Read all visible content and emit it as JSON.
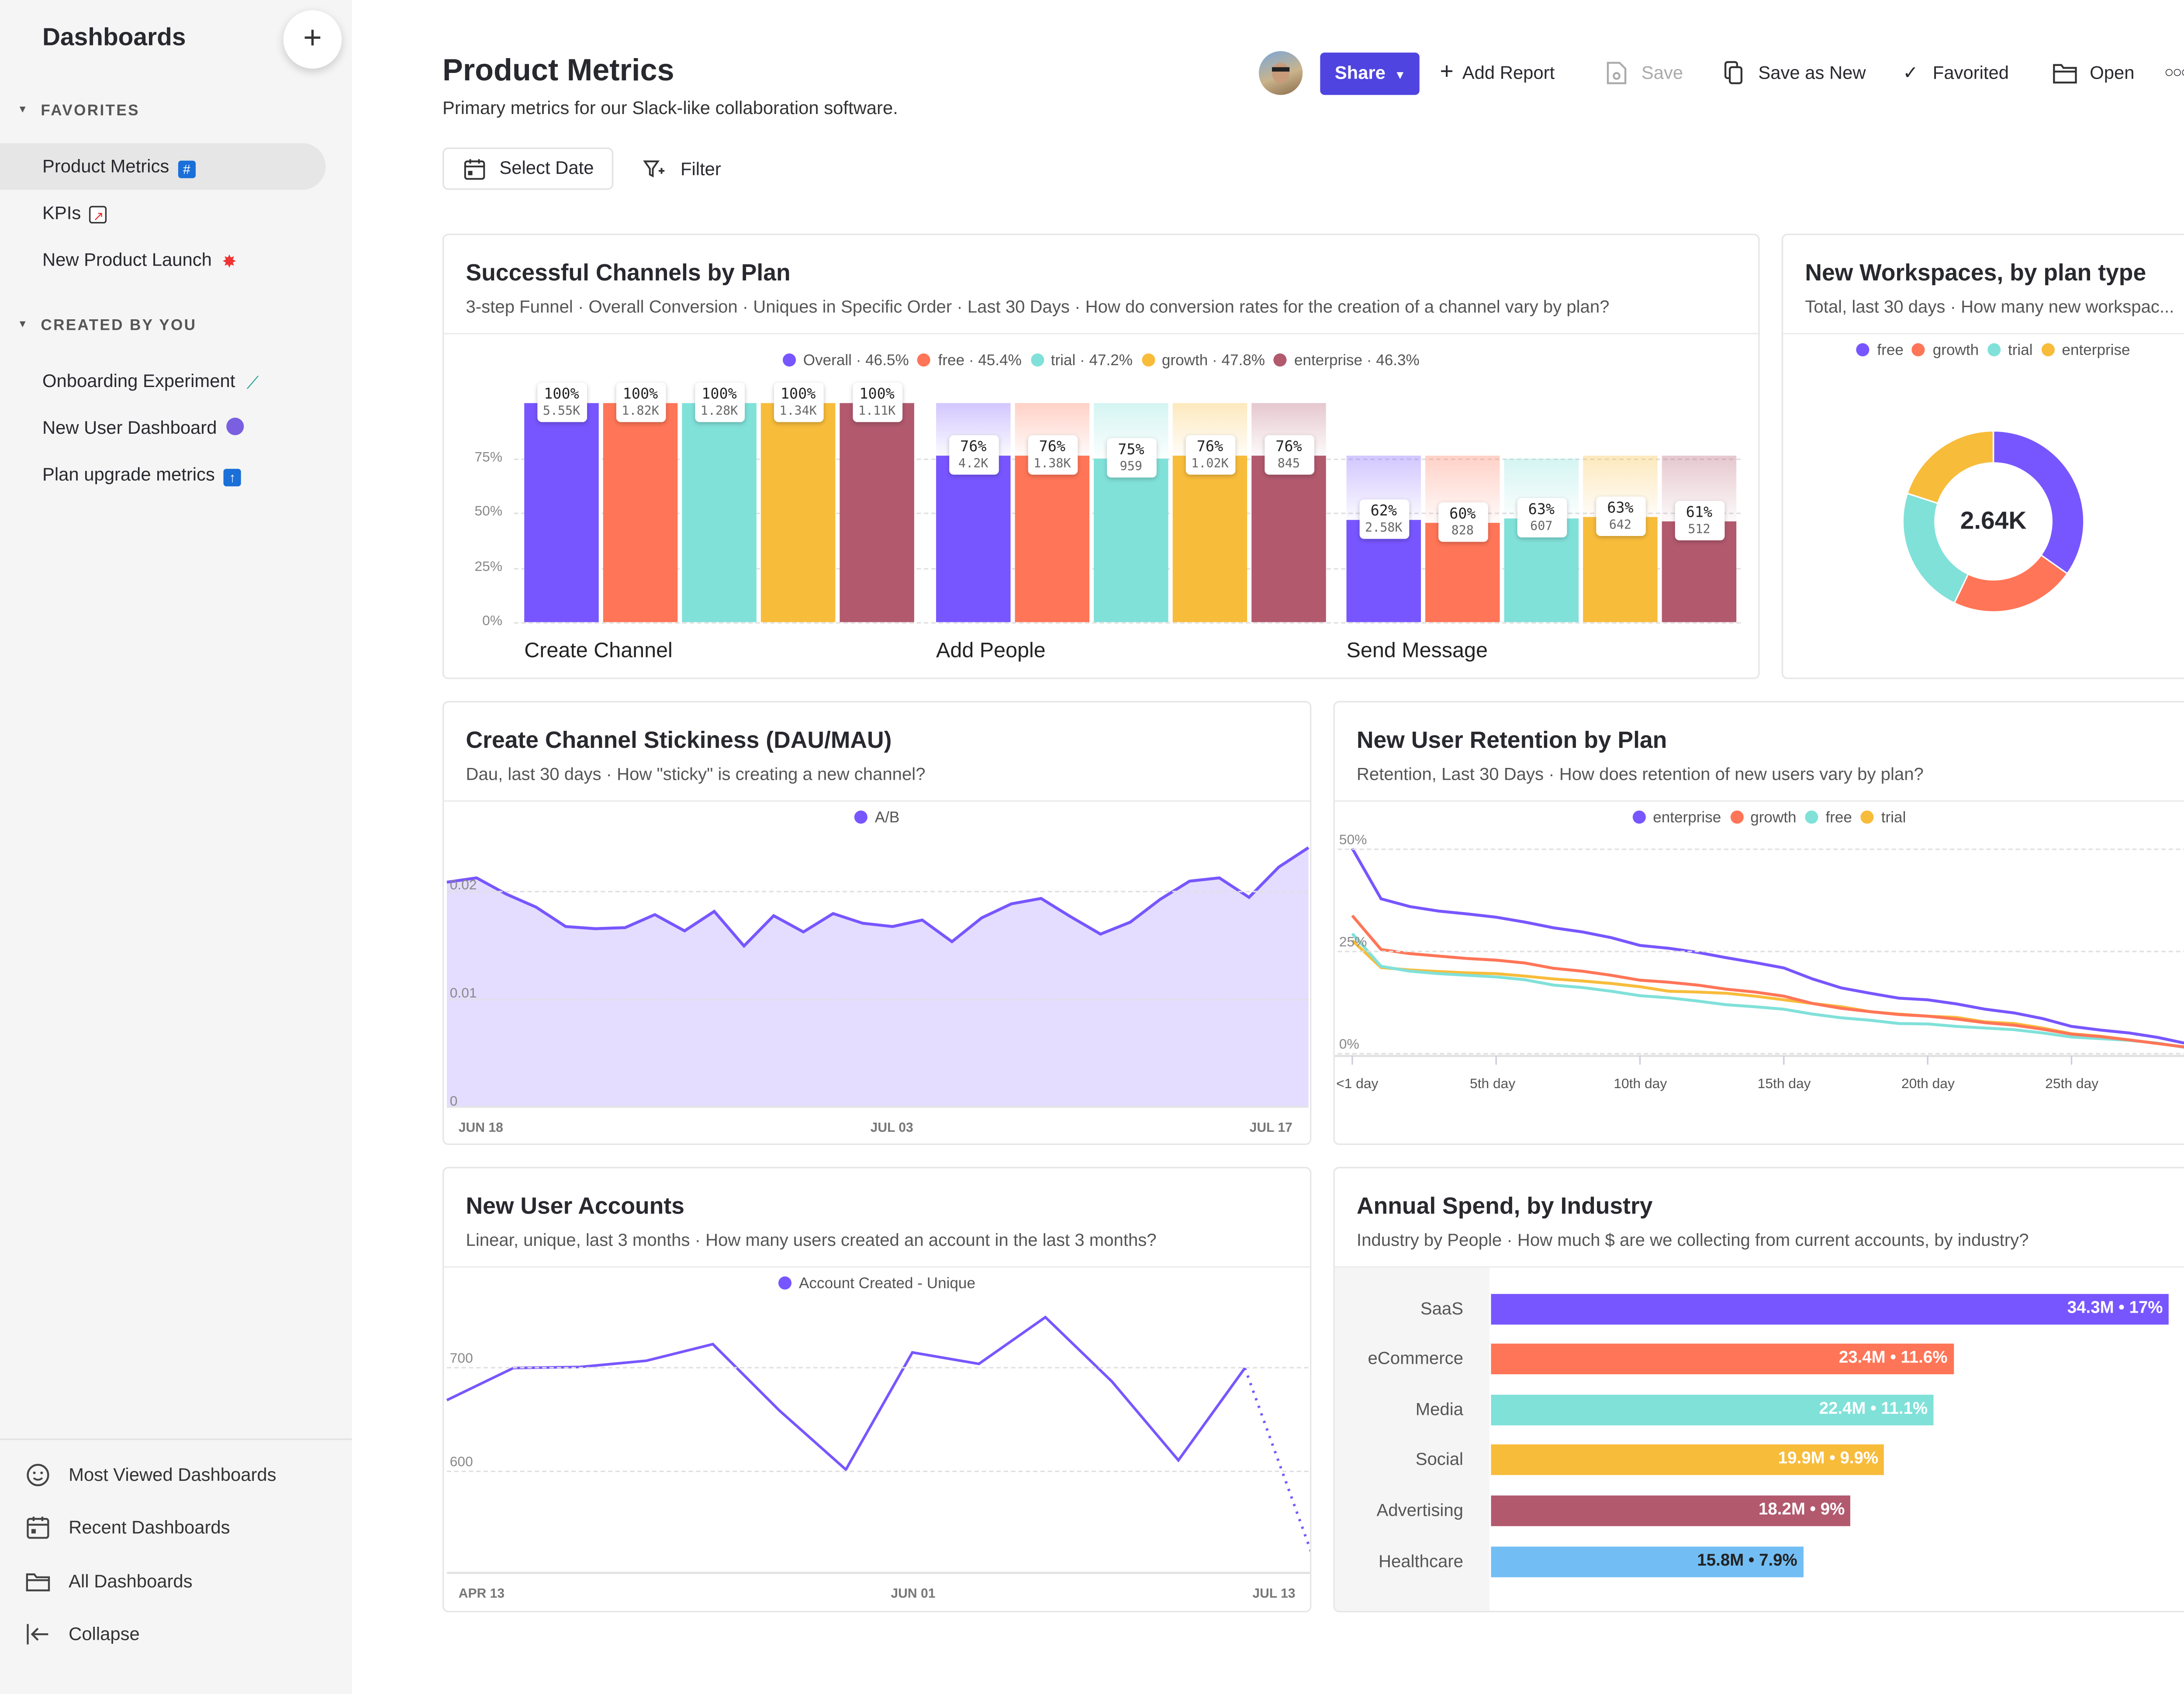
{
  "sidebar": {
    "title": "Dashboards",
    "add_icon": "plus-icon",
    "favorites_label": "FAVORITES",
    "favorites": [
      {
        "label": "Product Metrics",
        "icon": "hash-icon",
        "selected": true
      },
      {
        "label": "KPIs",
        "icon": "chart-increasing-icon"
      },
      {
        "label": "New Product Launch",
        "icon": "collision-icon"
      }
    ],
    "created_label": "CREATED BY YOU",
    "created": [
      {
        "label": "Onboarding Experiment",
        "icon": "test-tube-icon"
      },
      {
        "label": "New User Dashboard",
        "icon": "crystal-ball-icon"
      },
      {
        "label": "Plan upgrade metrics",
        "icon": "up-arrow-icon"
      }
    ],
    "bottom": [
      {
        "label": "Most Viewed Dashboards",
        "icon": "smiley-icon"
      },
      {
        "label": "Recent Dashboards",
        "icon": "calendar-icon"
      },
      {
        "label": "All Dashboards",
        "icon": "folder-icon"
      },
      {
        "label": "Collapse",
        "icon": "collapse-left-icon"
      }
    ]
  },
  "header": {
    "title": "Product Metrics",
    "subtitle": "Primary metrics for our Slack-like collaboration software.",
    "select_date": "Select Date",
    "filter": "Filter",
    "toolbar": {
      "share": "Share",
      "add_report": "Add Report",
      "save": "Save",
      "save_as_new": "Save as New",
      "favorited": "Favorited",
      "open": "Open"
    }
  },
  "colors": {
    "purple": "#7856ff",
    "orange": "#ff7557",
    "teal": "#80e1d9",
    "yellow": "#f8bc3b",
    "maroon": "#b2596e",
    "blue": "#72bef4",
    "share_button": "#4f44e0"
  },
  "cards": {
    "funnel": {
      "title": "Successful Channels by Plan",
      "subtitle": "3-step Funnel · Overall Conversion · Uniques in Specific Order · Last 30 Days · How do conversion rates for the creation of a channel vary by plan?"
    },
    "workspaces": {
      "title": "New Workspaces, by plan type",
      "subtitle": "Total, last 30 days · How many new workspac..."
    },
    "stickiness": {
      "title": "Create Channel Stickiness (DAU/MAU)",
      "subtitle": "Dau, last 30 days · How \"sticky\" is creating a new channel?"
    },
    "retention": {
      "title": "New User Retention by Plan",
      "subtitle": "Retention, Last 30 Days · How does retention of new users vary by plan?"
    },
    "accounts": {
      "title": "New User Accounts",
      "subtitle": "Linear, unique, last 3 months · How many users created an account in the last 3 months?"
    },
    "spend": {
      "title": "Annual Spend, by Industry",
      "subtitle": "Industry by People · How much $ are we collecting from current accounts, by industry?"
    }
  },
  "chart_data": [
    {
      "id": "funnel",
      "type": "bar",
      "legend": [
        "Overall · 46.5%",
        "free · 45.4%",
        "trial · 47.2%",
        "growth · 47.8%",
        "enterprise · 46.3%"
      ],
      "series_colors": [
        "#7856ff",
        "#ff7557",
        "#80e1d9",
        "#f8bc3b",
        "#b2596e"
      ],
      "yticks": [
        "0%",
        "25%",
        "50%",
        "75%"
      ],
      "ylim": [
        0,
        100
      ],
      "steps": [
        {
          "name": "Create Channel",
          "pct": [
            "100%",
            "100%",
            "100%",
            "100%",
            "100%"
          ],
          "count_labels": [
            "5.55K",
            "1.82K",
            "1.28K",
            "1.34K",
            "1.11K"
          ],
          "counts": [
            5550,
            1820,
            1280,
            1340,
            1110
          ]
        },
        {
          "name": "Add People",
          "pct": [
            "76%",
            "76%",
            "75%",
            "76%",
            "76%"
          ],
          "count_labels": [
            "4.2K",
            "1.38K",
            "959",
            "1.02K",
            "845"
          ],
          "counts": [
            4200,
            1380,
            959,
            1020,
            845
          ]
        },
        {
          "name": "Send Message",
          "pct": [
            "62%",
            "60%",
            "63%",
            "63%",
            "61%"
          ],
          "count_labels": [
            "2.58K",
            "828",
            "607",
            "642",
            "512"
          ],
          "counts": [
            2580,
            828,
            607,
            642,
            512
          ]
        }
      ]
    },
    {
      "id": "workspaces",
      "type": "pie",
      "center_label": "2.64K",
      "legend": [
        "free",
        "growth",
        "trial",
        "enterprise"
      ],
      "series_colors": [
        "#7856ff",
        "#ff7557",
        "#80e1d9",
        "#f8bc3b"
      ],
      "shares": [
        0.348,
        0.223,
        0.229,
        0.2
      ]
    },
    {
      "id": "stickiness",
      "type": "area",
      "legend": [
        "A/B"
      ],
      "series_colors": [
        "#7856ff"
      ],
      "yticks": [
        "0",
        "0.01",
        "0.02"
      ],
      "xticks": [
        "JUN 18",
        "JUL 03",
        "JUL 17"
      ],
      "x_start": "Jun 18",
      "x_end": "Jul 17",
      "values": [
        0.0208,
        0.0212,
        0.0197,
        0.0185,
        0.0167,
        0.0165,
        0.0166,
        0.0178,
        0.0163,
        0.0181,
        0.0149,
        0.0177,
        0.0162,
        0.0179,
        0.017,
        0.0167,
        0.0173,
        0.0153,
        0.0175,
        0.0188,
        0.0193,
        0.0176,
        0.016,
        0.0171,
        0.0192,
        0.0209,
        0.0212,
        0.0194,
        0.0222,
        0.024
      ]
    },
    {
      "id": "retention",
      "type": "line",
      "yticks": [
        "0%",
        "25%",
        "50%"
      ],
      "xticks": [
        "<1 day",
        "5th day",
        "10th day",
        "15th day",
        "20th day",
        "25th day"
      ],
      "series": [
        {
          "name": "enterprise",
          "color": "#7856ff",
          "values": [
            50,
            37.7,
            35.8,
            34.7,
            34,
            33.2,
            32,
            30.6,
            29.6,
            28.2,
            26.3,
            25.6,
            24.6,
            23.3,
            22.1,
            20.8,
            18.1,
            15.9,
            14.6,
            13.4,
            13,
            12,
            10.7,
            9.8,
            8.4,
            6.5,
            5.6,
            4.9,
            3.8,
            2.3
          ]
        },
        {
          "name": "growth",
          "color": "#ff7557",
          "values": [
            33.6,
            25.3,
            24.3,
            23.7,
            23.1,
            22.7,
            22,
            20.7,
            20,
            19,
            17.8,
            17.3,
            16.6,
            15.6,
            14.9,
            13.9,
            12.1,
            10.9,
            10.1,
            9.4,
            9,
            8.3,
            7.4,
            6.8,
            5.8,
            4.6,
            4,
            3.2,
            2.3,
            1.4
          ]
        },
        {
          "name": "free",
          "color": "#80e1d9",
          "values": [
            29.2,
            21.2,
            20,
            19.4,
            19,
            18.6,
            17.9,
            16.6,
            16,
            15.1,
            14,
            13.5,
            12.7,
            11.8,
            11.3,
            10.7,
            9.5,
            8.6,
            8,
            7.2,
            7.1,
            6.5,
            6.1,
            5.7,
            4.9,
            3.9,
            3.5,
            3.1,
            2.4,
            1.3
          ]
        },
        {
          "name": "trial",
          "color": "#f8bc3b",
          "values": [
            27.5,
            20.9,
            20.3,
            19.9,
            19.6,
            19.4,
            18.8,
            18.1,
            17.6,
            17,
            16.2,
            15.1,
            14.9,
            14.6,
            13.9,
            13,
            12.1,
            11.3,
            10.1,
            9.5,
            9,
            8.7,
            7.6,
            7.2,
            6.1,
            4.7,
            4.1,
            3.2,
            2.3,
            1.4
          ]
        }
      ]
    },
    {
      "id": "accounts",
      "type": "line",
      "legend": [
        "Account Created - Unique"
      ],
      "series_colors": [
        "#7856ff"
      ],
      "yticks": [
        "600",
        "700"
      ],
      "xticks": [
        "APR 13",
        "JUN 01",
        "JUL 13"
      ],
      "x": [
        "Apr 13",
        "Apr 20",
        "Apr 27",
        "May 04",
        "May 11",
        "May 18",
        "May 25",
        "Jun 01",
        "Jun 08",
        "Jun 15",
        "Jun 22",
        "Jun 29",
        "Jul 06",
        "Jul 13"
      ],
      "values": [
        668,
        699,
        700,
        706,
        722,
        658,
        601,
        714,
        703,
        748,
        686,
        610,
        699,
        521
      ],
      "last_point_partial": true
    },
    {
      "id": "spend",
      "type": "bar",
      "orientation": "horizontal",
      "categories": [
        "SaaS",
        "eCommerce",
        "Media",
        "Social",
        "Advertising",
        "Healthcare"
      ],
      "values": [
        34.3,
        23.4,
        22.4,
        19.9,
        18.2,
        15.8
      ],
      "labels": [
        "34.3M • 17%",
        "23.4M • 11.6%",
        "22.4M • 11.1%",
        "19.9M • 9.9%",
        "18.2M • 9%",
        "15.8M • 7.9%"
      ],
      "series_colors": [
        "#7856ff",
        "#ff7557",
        "#80e1d9",
        "#f8bc3b",
        "#b2596e",
        "#72bef4"
      ]
    }
  ]
}
